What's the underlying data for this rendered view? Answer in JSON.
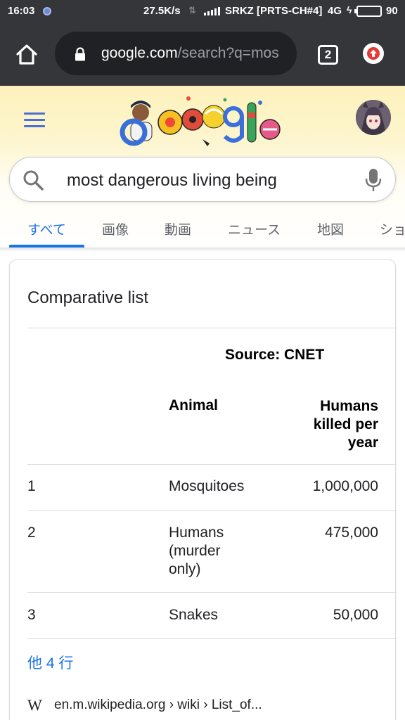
{
  "status_bar": {
    "time": "16:03",
    "speed": "27.5K/s",
    "carrier": "SRKZ [PRTS-CH#4]",
    "network": "4G",
    "battery": "90",
    "battery_level": 0.9
  },
  "browser": {
    "url_host": "google.com",
    "url_path": "/search?q=mos",
    "tab_count": "2"
  },
  "search": {
    "query": "most dangerous living being"
  },
  "tabs": [
    {
      "label": "すべて",
      "active": true
    },
    {
      "label": "画像"
    },
    {
      "label": "動画"
    },
    {
      "label": "ニュース"
    },
    {
      "label": "地図"
    },
    {
      "label": "ショ"
    }
  ],
  "card": {
    "title": "Comparative list",
    "source": "Source: CNET",
    "columns": [
      "",
      "Animal",
      "Humans killed per year"
    ],
    "rows": [
      {
        "rank": "1",
        "animal": "Mosquitoes",
        "killed": "1,000,000"
      },
      {
        "rank": "2",
        "animal": "Humans (murder only)",
        "killed": "475,000"
      },
      {
        "rank": "3",
        "animal": "Snakes",
        "killed": "50,000"
      }
    ],
    "more_rows": "他 4 行",
    "citation": "en.m.wikipedia.org › wiki › List_of...",
    "cite_logo": "W"
  },
  "colors": {
    "accent": "#1a73e8",
    "toolbar": "#35363a",
    "header_bg": "#fdf2bc"
  }
}
